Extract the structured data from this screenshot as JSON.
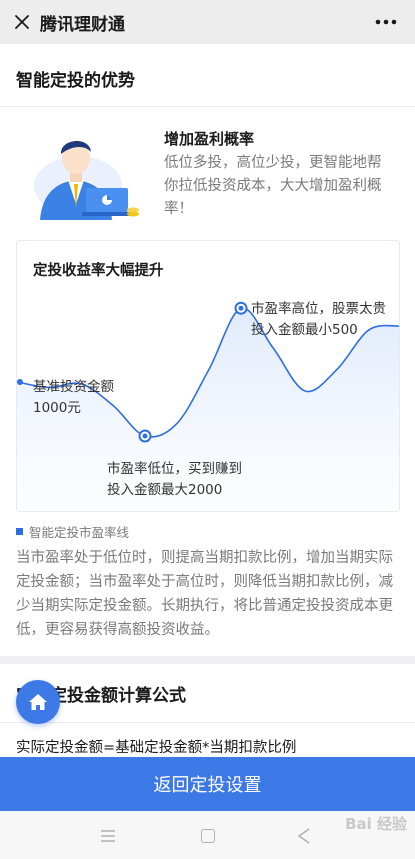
{
  "topbar": {
    "title": "腾讯理财通"
  },
  "card": {
    "title": "智能定投的优势",
    "advantage_title": "增加盈利概率",
    "advantage_desc": "低位多投，高位少投，更智能地帮你拉低投资成本，大大增加盈利概率！",
    "chart_title": "定投收益率大幅提升",
    "annotations": {
      "base_line1": "基准投资金额",
      "base_line2": "1000元",
      "low_line1": "市盈率低位，买到赚到",
      "low_line2": "投入金额最大2000",
      "high_line1": "市盈率高位，股票太贵",
      "high_line2": "投入金额最小500"
    },
    "legend_label": "智能定投市盈率线",
    "explain": "当市盈率处于低位时，则提高当期扣款比例，增加当期实际定投金额；当市盈率处于高位时，则降低当期扣款比例，减少当期实际定投金额。长期执行，将比普通定投投资成本更低，更容易获得高额投资收益。"
  },
  "card2": {
    "title": "实际定投金额计算公式",
    "formula": "实际定投金额=基础定投金额*当期扣款比例"
  },
  "bottom_button": "返回定投设置",
  "watermark": "Bai 经验",
  "colors": {
    "primary": "#3c78e6",
    "line": "#2f6ee0"
  },
  "chart_data": {
    "type": "area",
    "series": [
      {
        "name": "智能定投市盈率线",
        "values": [
          0.55,
          0.52,
          0.54,
          0.42,
          0.25,
          0.32,
          0.62,
          0.96,
          0.74,
          0.5,
          0.62,
          0.84,
          0.86
        ]
      }
    ],
    "markers": [
      {
        "label": "市盈率低位，买到赚到",
        "point_index": 4
      },
      {
        "label": "市盈率高位，股票太贵",
        "point_index": 7
      }
    ],
    "icons": [
      "close-icon",
      "more-icon",
      "home-icon"
    ]
  }
}
